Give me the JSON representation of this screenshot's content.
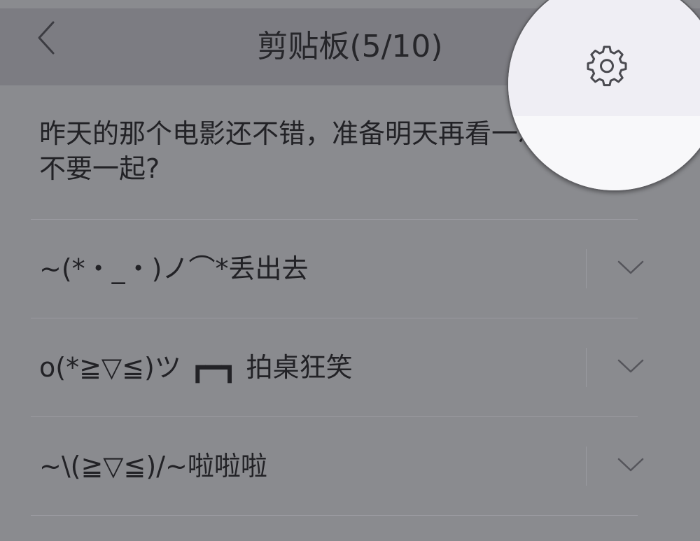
{
  "header": {
    "title": "剪贴板(5/10)",
    "back_icon": "chevron-left-icon",
    "settings_icon": "gear-icon"
  },
  "clipboard": {
    "first_entry": "昨天的那个电影还不错，准备明天再看一次，你要不要一起?",
    "items": [
      {
        "text": "~(*・_・)ノ⌒*丢出去",
        "expand_icon": "chevron-down-icon"
      },
      {
        "text": "o(*≧▽≦)ツ ┏━┓ 拍桌狂笑",
        "expand_icon": "chevron-down-icon"
      },
      {
        "text": "~\\(≧▽≦)/~啦啦啦",
        "expand_icon": "chevron-down-icon"
      }
    ]
  },
  "colors": {
    "overlay_background": "#8a8b8f",
    "header_background": "#7c7c82",
    "magnifier_header": "#efeef4",
    "magnifier_body": "#f8f8fa",
    "icon": "#4a4a50"
  }
}
